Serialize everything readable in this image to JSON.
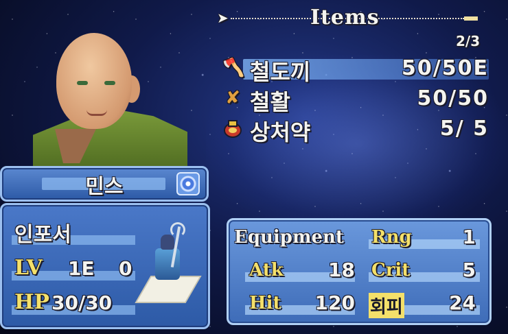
{
  "items_header": {
    "title": "Items",
    "page": "2/3"
  },
  "items": [
    {
      "name": "철도끼",
      "uses": "50/50E",
      "icon": "axe-icon",
      "selected": true
    },
    {
      "name": "철활",
      "uses": "50/50",
      "icon": "bow-icon",
      "selected": false
    },
    {
      "name": "상처약",
      "uses": "5/ 5",
      "icon": "potion-icon",
      "selected": false
    }
  ],
  "unit": {
    "name": "민스",
    "class": "인포서",
    "lv_label": "LV",
    "lv_value": "1E",
    "exp_value": "0",
    "hp_label": "HP",
    "hp_value": "30/30",
    "affinity_icon": "affinity-ice-icon"
  },
  "equipment": {
    "title": "Equipment",
    "rng_label": "Rng",
    "rng_value": "1",
    "atk_label": "Atk",
    "atk_value": "18",
    "crit_label": "Crit",
    "crit_value": "5",
    "hit_label": "Hit",
    "hit_value": "120",
    "avoid_label": "회피",
    "avoid_value": "24"
  }
}
